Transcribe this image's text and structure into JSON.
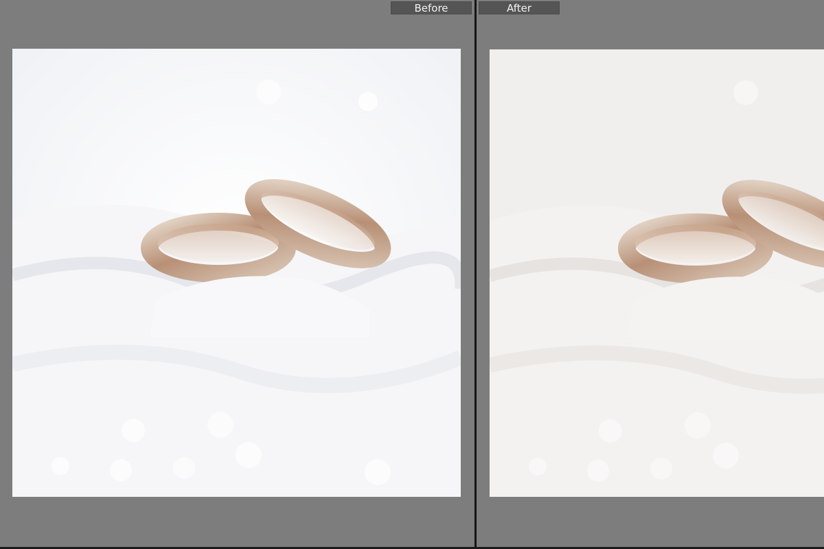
{
  "compare_view": {
    "before_label": "Before",
    "after_label": "After"
  },
  "photo": {
    "subject": "wedding-rings-on-white-fabric"
  },
  "colors": {
    "workspace_bg": "#7d7d7d",
    "divider": "#151515",
    "label_bg": "#555555",
    "label_text": "#f2f2f2"
  }
}
